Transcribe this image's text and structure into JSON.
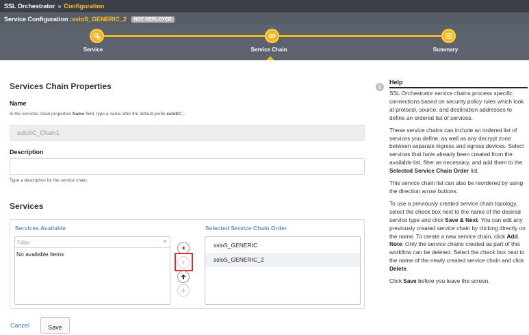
{
  "breadcrumb": {
    "root": "SSL Orchestrator",
    "separator": "»",
    "current": "Configuration"
  },
  "config": {
    "label": "Service Configuration :",
    "name": "ssloS_GENERIC_2",
    "status": "NOT DEPLOYED"
  },
  "stepper": {
    "steps": [
      {
        "label": "Service",
        "icon": "gears-icon"
      },
      {
        "label": "Service Chain",
        "icon": "chain-link-icon"
      },
      {
        "label": "Summary",
        "icon": "summary-list-icon"
      }
    ],
    "active_index": 1,
    "accent": "#f6b71e"
  },
  "props": {
    "title": "Services Chain Properties",
    "name_label": "Name",
    "name_hint_pre": "In the services chain properties ",
    "name_hint_bold1": "Name",
    "name_hint_mid": " field, type a name after the default prefix ",
    "name_hint_bold2": "ssloSC_",
    "name_hint_post": ".",
    "name_value": "ssloSC_Chain1",
    "description_label": "Description",
    "description_value": "",
    "description_hint": "Type a description for the service chain."
  },
  "services": {
    "title": "Services",
    "available_title": "Services Available",
    "filter_placeholder": "Filter",
    "available_empty": "No available items",
    "selected_title": "Selected Service Chain Order",
    "selected_items": [
      "ssloS_GENERIC",
      "ssloS_GENERIC_2"
    ]
  },
  "actions": {
    "cancel": "Cancel",
    "save": "Save"
  },
  "help": {
    "title": "Help",
    "p1": "SSL Orchestrator service chains process specific connections based on security policy rules which look at protocol, source, and destination addresses to define an ordered list of services.",
    "p2_a": "These service chains can include an ordered list of services you define, as well as any decrypt zone between separate ingress and egress devices. Select services that have already been created from the available list, filter as necessary, and add them to the ",
    "p2_b": "Selected Service Chain Order",
    "p2_c": " list.",
    "p3": "This service chain list can also be reordered by using the direction arrow buttons.",
    "p4_a": "To use a previously created service chain topology, select the check box next to the name of the desired service type and click ",
    "p4_b": "Save & Next",
    "p4_c": ". You can edit any previously created service chain by clicking directly on the name. To create a new service chain, click ",
    "p4_d": "Add",
    "p4_e": ". ",
    "p4_f": "Note",
    "p4_g": ": Only the service chains created as part of this workflow can be deleted. Select the check box next to the name of the newly created service chain and click ",
    "p4_h": "Delete",
    "p4_i": ".",
    "p5_a": "Click ",
    "p5_b": "Save",
    "p5_c": " before you leave the screen."
  }
}
